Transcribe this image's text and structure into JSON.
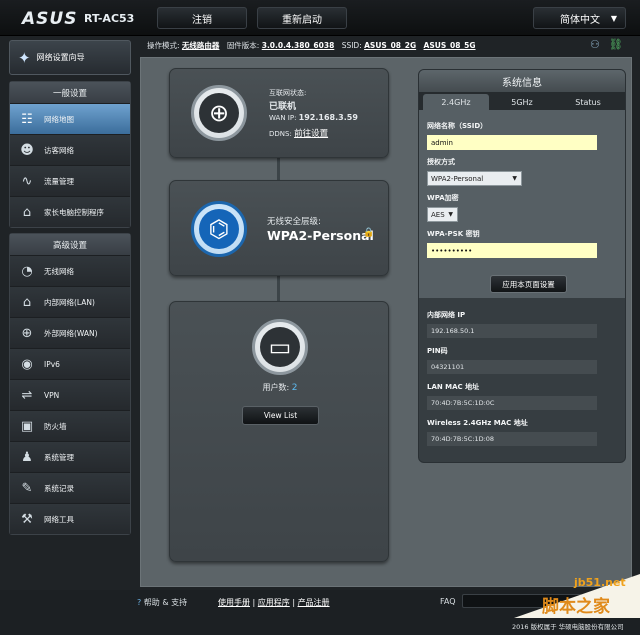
{
  "header": {
    "logo": "ASUS",
    "model": "RT-AC53",
    "logout_label": "注销",
    "reboot_label": "重新启动",
    "language": "简体中文"
  },
  "status": {
    "mode_label": "操作模式:",
    "mode_value": "无线路由器",
    "fw_label": "固件版本:",
    "fw_value": "3.0.0.4.380_6038",
    "ssid_label": "SSID:",
    "ssid_2g": "ASUS_08_2G",
    "ssid_5g": "ASUS_08_5G"
  },
  "sidebar": {
    "quick_setup": "网络设置向导",
    "general_title": "一般设置",
    "general_items": [
      {
        "label": "网络地图",
        "icon": "network-map-icon"
      },
      {
        "label": "访客网络",
        "icon": "guest-network-icon"
      },
      {
        "label": "流量管理",
        "icon": "traffic-icon"
      },
      {
        "label": "家长电脑控制程序",
        "icon": "parental-icon"
      }
    ],
    "advanced_title": "高级设置",
    "advanced_items": [
      {
        "label": "无线网络",
        "icon": "wifi-icon"
      },
      {
        "label": "内部网络(LAN)",
        "icon": "lan-icon"
      },
      {
        "label": "外部网络(WAN)",
        "icon": "wan-icon"
      },
      {
        "label": "IPv6",
        "icon": "ipv6-icon"
      },
      {
        "label": "VPN",
        "icon": "vpn-icon"
      },
      {
        "label": "防火墙",
        "icon": "firewall-icon"
      },
      {
        "label": "系统管理",
        "icon": "admin-icon"
      },
      {
        "label": "系统记录",
        "icon": "log-icon"
      },
      {
        "label": "网络工具",
        "icon": "tools-icon"
      }
    ]
  },
  "map": {
    "internet_status_label": "互联网状态:",
    "internet_status": "已联机",
    "wan_ip_label": "WAN IP:",
    "wan_ip": "192.168.3.59",
    "ddns_label": "DDNS:",
    "ddns_value": "前往设置",
    "security_label": "无线安全层级:",
    "security_value": "WPA2-Personal",
    "clients_label": "用户数:",
    "clients_count": "2",
    "view_list": "View List"
  },
  "sysinfo": {
    "title": "系统信息",
    "tabs": [
      "2.4GHz",
      "5GHz",
      "Status"
    ],
    "ssid_label": "网络名称（SSID）",
    "ssid_value": "admin",
    "auth_label": "授权方式",
    "auth_value": "WPA2-Personal",
    "enc_label": "WPA加密",
    "enc_value": "AES",
    "psk_label": "WPA-PSK 密钥",
    "psk_value": "••••••••••",
    "apply_label": "应用本页面设置",
    "lan_ip_label": "内部网络 IP",
    "lan_ip": "192.168.50.1",
    "pin_label": "PIN码",
    "pin": "04321101",
    "lan_mac_label": "LAN MAC 地址",
    "lan_mac": "70:4D:7B:5C:1D:0C",
    "wmac_label": "Wireless 2.4GHz MAC 地址",
    "wmac": "70:4D:7B:5C:1D:08"
  },
  "footer": {
    "help": "帮助 & 支持",
    "manual": "使用手册",
    "app": "应用程序",
    "register": "产品注册",
    "faq": "FAQ",
    "copyright": "2016 版权属于 华硕电脑股份有限公司"
  },
  "watermark": {
    "site": "jb51.net",
    "name": "脚本之家"
  }
}
